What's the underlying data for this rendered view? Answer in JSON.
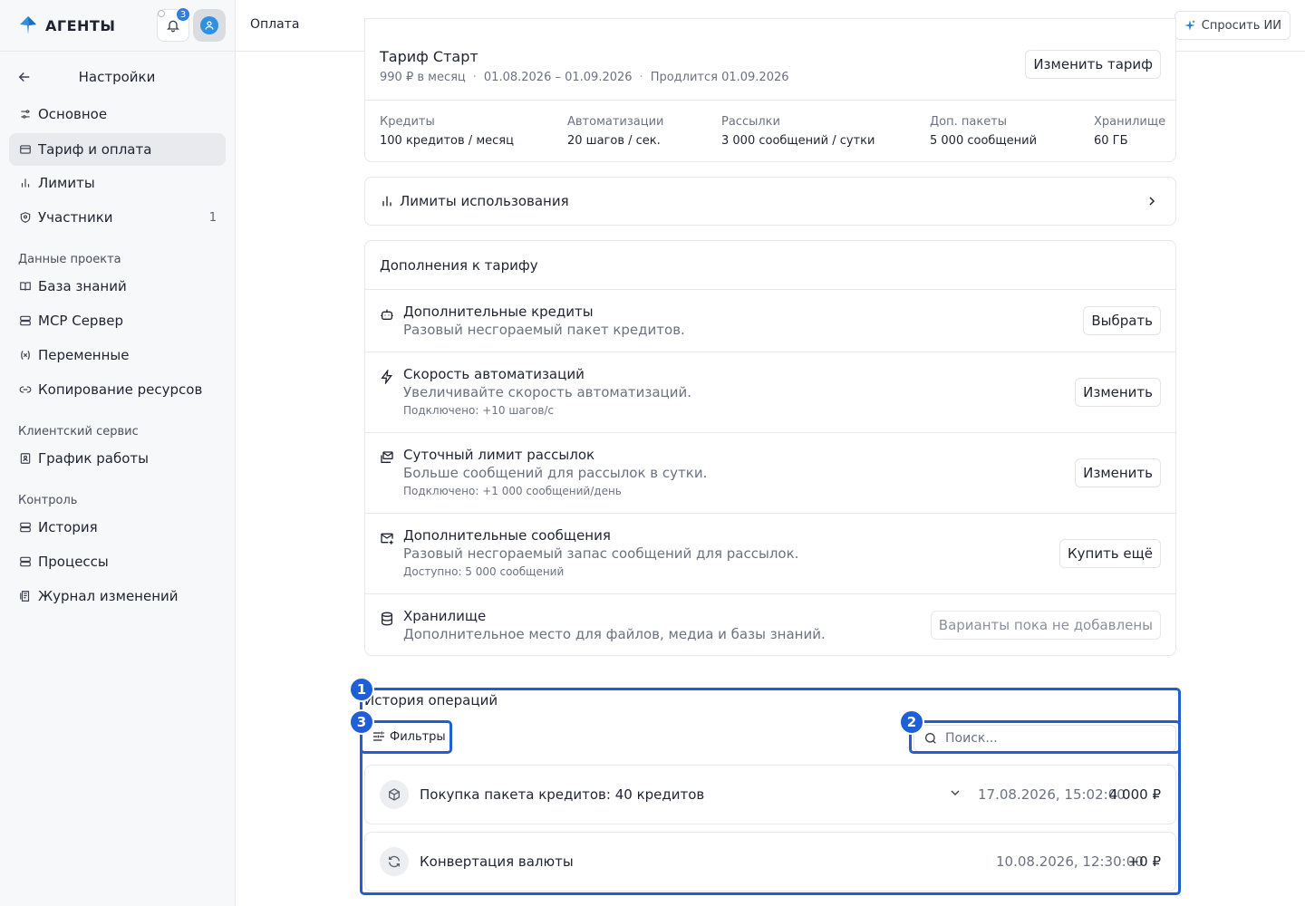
{
  "app": {
    "brand": "АГЕНТЫ",
    "notifications_count": "3"
  },
  "topbar": {
    "title": "Оплата",
    "ask_ai": "Спросить ИИ"
  },
  "sidebar": {
    "back_title": "Настройки",
    "items": [
      {
        "label": "Основное",
        "icon": "sliders-icon"
      },
      {
        "label": "Тариф и оплата",
        "icon": "credit-card-icon",
        "active": true
      },
      {
        "label": "Лимиты",
        "icon": "bar-chart-icon"
      },
      {
        "label": "Участники",
        "icon": "users-icon",
        "count": "1"
      }
    ],
    "sections": [
      {
        "title": "Данные проекта",
        "items": [
          {
            "label": "База знаний",
            "icon": "book-icon"
          },
          {
            "label": "MCP Сервер",
            "icon": "server-icon"
          },
          {
            "label": "Переменные",
            "icon": "variable-icon"
          },
          {
            "label": "Копирование ресурсов",
            "icon": "link-icon"
          }
        ]
      },
      {
        "title": "Клиентский сервис",
        "items": [
          {
            "label": "График работы",
            "icon": "calendar-user-icon"
          }
        ]
      },
      {
        "title": "Контроль",
        "items": [
          {
            "label": "История",
            "icon": "history-icon"
          },
          {
            "label": "Процессы",
            "icon": "processes-icon"
          },
          {
            "label": "Журнал изменений",
            "icon": "log-icon"
          }
        ]
      }
    ]
  },
  "plan": {
    "name": "Тариф Старт",
    "price": "990 ₽ в месяц",
    "period": "01.08.2026 – 01.09.2026",
    "renewal": "Продлится 01.09.2026",
    "change_button": "Изменить тариф",
    "stats": [
      {
        "label": "Кредиты",
        "value": "100 кредитов / месяц"
      },
      {
        "label": "Автоматизации",
        "value": "20 шагов / сек."
      },
      {
        "label": "Рассылки",
        "value": "3 000 сообщений / сутки"
      },
      {
        "label": "Доп. пакеты",
        "value": "5 000 сообщений"
      },
      {
        "label": "Хранилище",
        "value": "60 ГБ"
      }
    ]
  },
  "limits": {
    "title": "Лимиты использования"
  },
  "addons": {
    "title": "Дополнения к тарифу",
    "items": [
      {
        "name": "Дополнительные кредиты",
        "desc": "Разовый несгораемый пакет кредитов.",
        "note": "",
        "button": "Выбрать",
        "icon": "robot-icon"
      },
      {
        "name": "Скорость автоматизаций",
        "desc": "Увеличивайте скорость автоматизаций.",
        "note": "Подключено: +10 шагов/с",
        "button": "Изменить",
        "icon": "lightning-icon"
      },
      {
        "name": "Суточный лимит рассылок",
        "desc": "Больше сообщений для рассылок в сутки.",
        "note": "Подключено: +1 000 сообщений/день",
        "button": "Изменить",
        "icon": "mail-stack-icon"
      },
      {
        "name": "Дополнительные сообщения",
        "desc": "Разовый несгораемый запас сообщений для рассылок.",
        "note": "Доступно: 5 000 сообщений",
        "button": "Купить ещё",
        "icon": "mail-plus-icon"
      },
      {
        "name": "Хранилище",
        "desc": "Дополнительное место для файлов, медиа и базы знаний.",
        "note": "",
        "empty": "Варианты пока не добавлены",
        "icon": "database-icon"
      }
    ]
  },
  "operations": {
    "title": "История операций",
    "filters_label": "Фильтры",
    "search_placeholder": "Поиск...",
    "rows": [
      {
        "title": "Покупка пакета кредитов: 40 кредитов",
        "date": "17.08.2026, 15:02:00",
        "amount": "4 000 ₽",
        "icon": "package-icon"
      },
      {
        "title": "Конвертация валюты",
        "date": "10.08.2026, 12:30:00",
        "amount": "+0 ₽",
        "icon": "refresh-icon"
      }
    ]
  },
  "annotations": [
    "1",
    "2",
    "3"
  ],
  "colors": {
    "accent": "#2f7de1",
    "annotation": "#1f5fd6"
  }
}
